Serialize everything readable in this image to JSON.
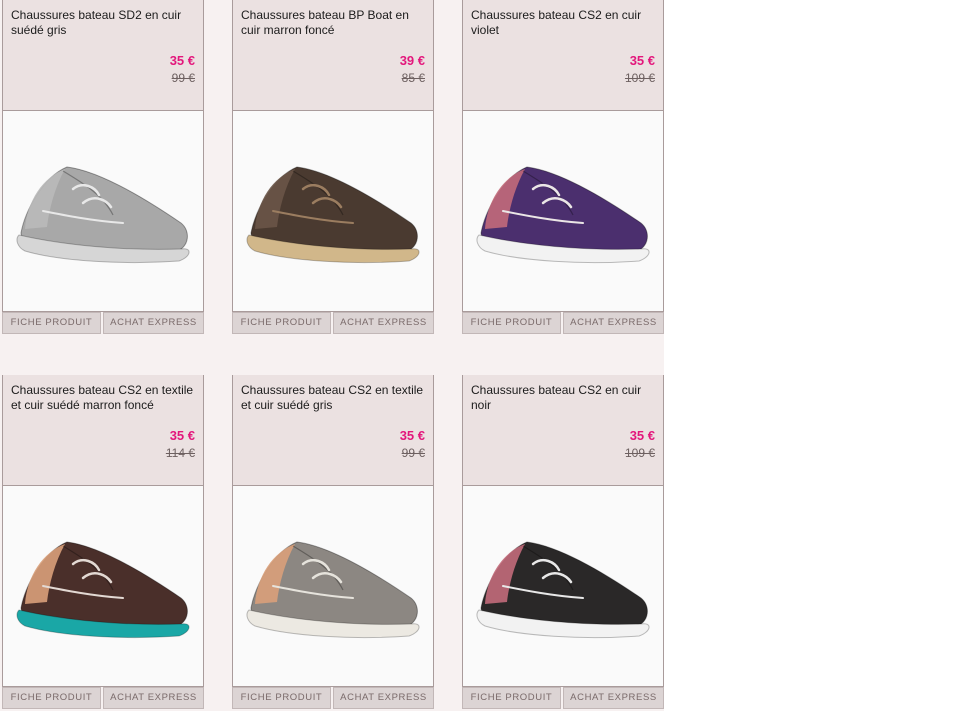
{
  "products": [
    {
      "title": "Chaussures bateau SD2 en cuir suédé gris",
      "price": "35 €",
      "old_price": "99 €",
      "fiche_label": "FICHE PRODUIT",
      "achat_label": "ACHAT EXPRESS",
      "image": "grey-suede-boat-shoe",
      "upper": "#a8a8a8",
      "sole": "#d6d6d6",
      "laces": "#e8e8e8",
      "lining": "#b9b9b9"
    },
    {
      "title": "Chaussures bateau BP Boat en cuir marron foncé",
      "price": "39 €",
      "old_price": "85 €",
      "fiche_label": "FICHE PRODUIT",
      "achat_label": "ACHAT EXPRESS",
      "image": "dark-brown-boat-shoe",
      "upper": "#4a3a30",
      "sole": "#d1b78a",
      "laces": "#9b7d60",
      "lining": "#6a5548"
    },
    {
      "title": "Chaussures bateau CS2 en cuir violet",
      "price": "35 €",
      "old_price": "109 €",
      "fiche_label": "FICHE PRODUIT",
      "achat_label": "ACHAT EXPRESS",
      "image": "purple-boat-shoe",
      "upper": "#4b2f6e",
      "sole": "#f2f2f2",
      "laces": "#ebe6e6",
      "lining": "#c26a7a"
    },
    {
      "title": "Chaussures bateau CS2 en textile et cuir suédé marron foncé",
      "price": "35 €",
      "old_price": "114 €",
      "fiche_label": "FICHE PRODUIT",
      "achat_label": "ACHAT EXPRESS",
      "image": "brown-teal-boat-shoe",
      "upper": "#4a2f2a",
      "sole": "#1aa7a6",
      "laces": "#e3d9d3",
      "lining": "#d9a07a"
    },
    {
      "title": "Chaussures bateau CS2 en textile et cuir suédé gris",
      "price": "35 €",
      "old_price": "99 €",
      "fiche_label": "FICHE PRODUIT",
      "achat_label": "ACHAT EXPRESS",
      "image": "grey-textile-boat-shoe",
      "upper": "#8c8782",
      "sole": "#ece9e2",
      "laces": "#e6e3dc",
      "lining": "#d9a07a"
    },
    {
      "title": "Chaussures bateau CS2 en cuir noir",
      "price": "35 €",
      "old_price": "109 €",
      "fiche_label": "FICHE PRODUIT",
      "achat_label": "ACHAT EXPRESS",
      "image": "black-boat-shoe",
      "upper": "#2a2828",
      "sole": "#f2f2f2",
      "laces": "#e8e8e8",
      "lining": "#c26a7a"
    }
  ]
}
